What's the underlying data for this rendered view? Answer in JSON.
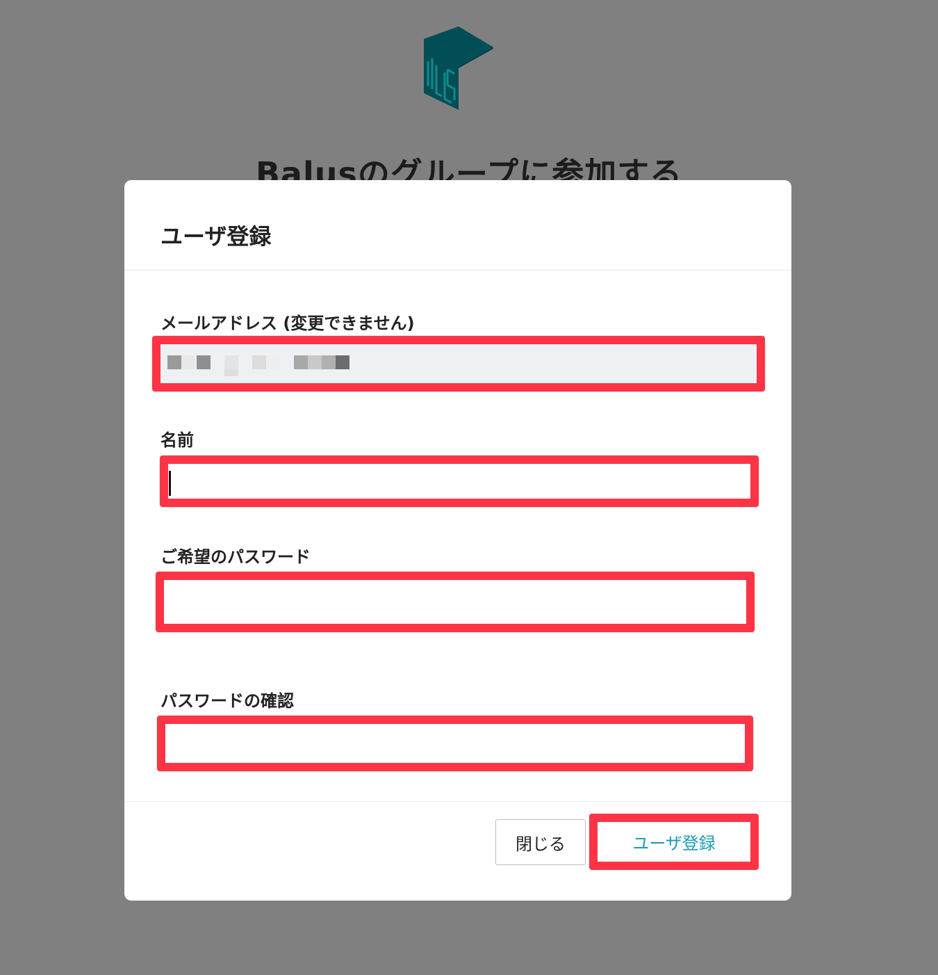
{
  "background": {
    "page_title": "Balusのグループに参加する"
  },
  "colors": {
    "overlay": "#808080",
    "highlight": "#fc3445",
    "brand_teal": "#024e55",
    "primary_text_button": "#1a9bb3"
  },
  "modal": {
    "title": "ユーザ登録",
    "fields": {
      "email": {
        "label": "メールアドレス (変更できません)",
        "value": ""
      },
      "name": {
        "label": "名前",
        "value": ""
      },
      "password": {
        "label": "ご希望のパスワード",
        "value": ""
      },
      "password_confirm": {
        "label": "パスワードの確認",
        "value": ""
      }
    },
    "buttons": {
      "close": "閉じる",
      "register": "ユーザ登録"
    }
  }
}
